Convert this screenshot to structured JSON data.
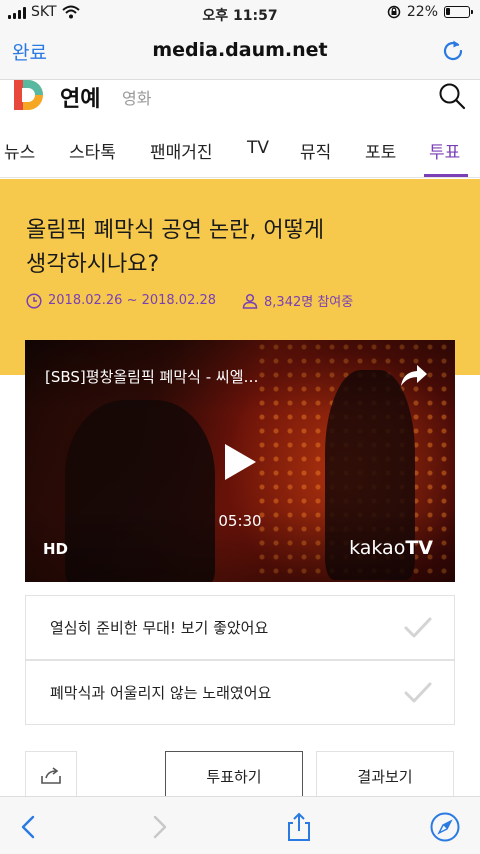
{
  "status_bar": {
    "carrier": "SKT",
    "time": "오후 11:57",
    "battery_percent": "22%",
    "battery_level": 0.22,
    "icons": [
      "signal-icon",
      "wifi-icon",
      "rotation-lock-icon",
      "battery-icon"
    ]
  },
  "browser": {
    "done_label": "완료",
    "url": "media.daum.net",
    "reload_icon": "reload-icon"
  },
  "header": {
    "logo": "daum-logo",
    "section": "연예",
    "sub_section": "영화",
    "search_icon": "search-icon"
  },
  "tabs": [
    {
      "label": "뉴스"
    },
    {
      "label": "스타톡"
    },
    {
      "label": "팬매거진"
    },
    {
      "label": "TV"
    },
    {
      "label": "뮤직"
    },
    {
      "label": "포토"
    },
    {
      "label": "투표",
      "active": true
    }
  ],
  "poll": {
    "title_line1": "올림픽 폐막식 공연 논란, 어떻게",
    "title_line2": "생각하시나요?",
    "period": "2018.02.26 ~ 2018.02.28",
    "participants": "8,342명 참여중",
    "accent_color": "#7a3fb5",
    "background_color": "#f6c94d"
  },
  "video": {
    "title": "[SBS]평창올림픽 폐막식 - 씨엘…",
    "duration": "05:30",
    "quality": "HD",
    "brand_prefix": "kakao",
    "brand_suffix": "TV"
  },
  "options": [
    {
      "label": "열심히 준비한 무대! 보기 좋았어요"
    },
    {
      "label": "폐막식과 어울리지 않는 노래였어요"
    }
  ],
  "actions": {
    "vote_label": "투표하기",
    "results_label": "결과보기"
  },
  "toolbar": {
    "icons": [
      "back-icon",
      "forward-icon",
      "share-icon",
      "safari-compass-icon"
    ]
  }
}
